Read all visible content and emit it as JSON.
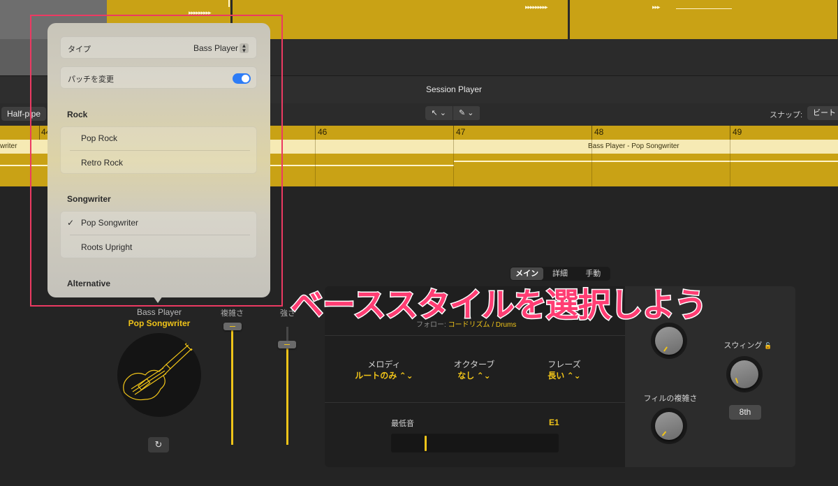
{
  "window": {
    "title": "Session Player"
  },
  "toolbar": {
    "region_label": "Half-pipe",
    "pointer_tool": "↖ ⌄",
    "pencil_tool": "✎ ⌄",
    "snap_label": "スナップ:",
    "snap_value": "ビート"
  },
  "ruler": {
    "bars": [
      "44",
      "46",
      "47",
      "48",
      "49"
    ]
  },
  "region": {
    "name": "Bass Player - Pop Songwriter",
    "left_name": "writer"
  },
  "player": {
    "name": "Bass Player",
    "style": "Pop Songwriter",
    "refresh_icon": "↻",
    "complexity_label": "複雑さ",
    "intensity_label": "強さ"
  },
  "tabs": [
    {
      "label": "メイン",
      "active": true
    },
    {
      "label": "詳細",
      "active": false
    },
    {
      "label": "手動",
      "active": false
    }
  ],
  "follow": {
    "label": "フォロー:",
    "value": "コードリズム / Drums"
  },
  "params": {
    "melody": {
      "label": "メロディ",
      "value": "ルートのみ ⌃⌄"
    },
    "octave": {
      "label": "オクターブ",
      "value": "なし ⌃⌄"
    },
    "phrase": {
      "label": "フレーズ",
      "value": "長い ⌃⌄"
    }
  },
  "lowest_note": {
    "label": "最低音",
    "value": "E1"
  },
  "knobs": {
    "swing_label": "スウィング",
    "fill_label": "フィルの複雑さ",
    "swing_value": "8th",
    "lock_icon": "🔓"
  },
  "popover": {
    "type_label": "タイプ",
    "type_value": "Bass Player",
    "patch_label": "パッチを変更",
    "patch_on": true,
    "sections": [
      {
        "title": "Rock",
        "items": [
          "Pop Rock",
          "Retro Rock"
        ]
      },
      {
        "title": "Songwriter",
        "items": [
          "Pop Songwriter",
          "Roots Upright"
        ]
      },
      {
        "title": "Alternative",
        "items": []
      }
    ],
    "selected": "Pop Songwriter",
    "check_mark": "✓"
  },
  "callout": "ベーススタイルを選択しよう",
  "colors": {
    "accent": "#f0c419",
    "region": "#c9a215",
    "callout": "#ff3d73",
    "highlight": "#ec3a62",
    "toggle": "#2d7cf6"
  }
}
